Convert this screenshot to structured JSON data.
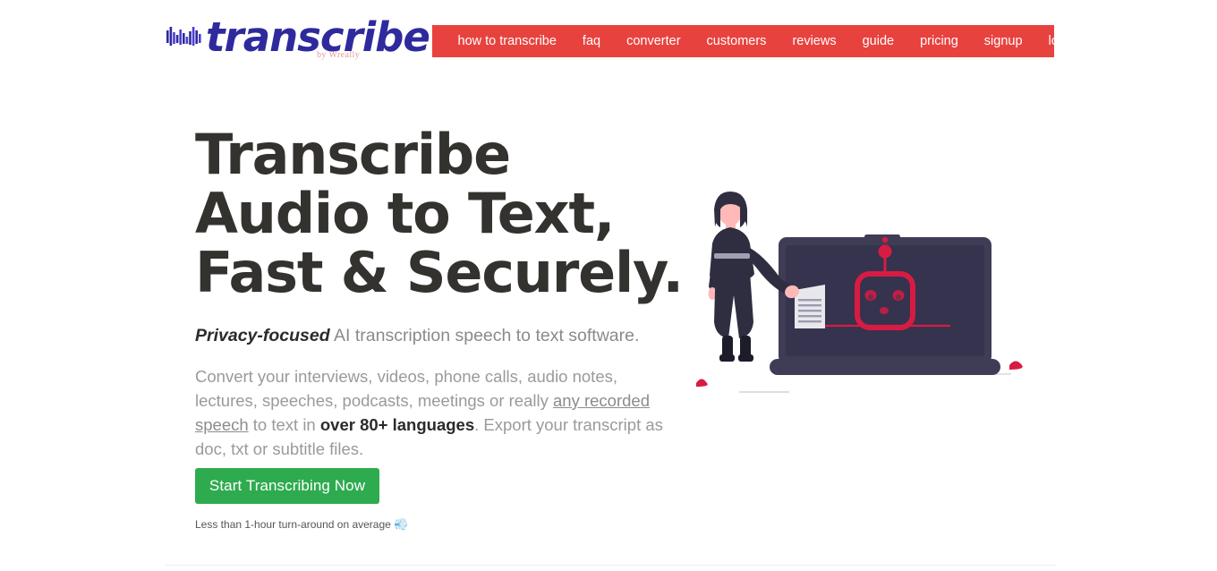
{
  "brand": {
    "wordmark": "transcribe",
    "tagline": "by Wreally",
    "logo_icon": "waveform-icon",
    "wordmark_color": "#2e2a9e",
    "tagline_color": "#e59aa0"
  },
  "nav": {
    "background_color": "#e8423f",
    "text_color": "#ffffff",
    "items": [
      {
        "label": "how to transcribe",
        "name": "nav-how-to-transcribe"
      },
      {
        "label": "faq",
        "name": "nav-faq"
      },
      {
        "label": "converter",
        "name": "nav-converter"
      },
      {
        "label": "customers",
        "name": "nav-customers"
      },
      {
        "label": "reviews",
        "name": "nav-reviews"
      },
      {
        "label": "guide",
        "name": "nav-guide"
      },
      {
        "label": "pricing",
        "name": "nav-pricing"
      },
      {
        "label": "signup",
        "name": "nav-signup"
      },
      {
        "label": "login",
        "name": "nav-login"
      }
    ]
  },
  "hero": {
    "heading_line1": "Transcribe",
    "heading_line2": "Audio to Text,",
    "heading_line3": "Fast & Securely.",
    "heading_color": "#33322f",
    "subheading_strong": "Privacy-focused",
    "subheading_rest": " AI transcription speech to text software.",
    "body_part1": "Convert your interviews, videos, phone calls, audio notes, lectures, speeches, podcasts, meetings or really ",
    "body_link": "any recorded speech",
    "body_part2": " to text in ",
    "body_bold": "over 80+ languages",
    "body_part3": ". Export your transcript as doc, txt or subtitle files."
  },
  "cta": {
    "button_label": "Start Transcribing Now",
    "button_color": "#2eab4f",
    "note_text": "Less than 1-hour turn-around on average",
    "note_emoji": "💨"
  },
  "illustration": {
    "name": "woman-with-laptop-robot-illustration",
    "description": "Woman standing beside a laptop showing a red robot face, holding a document",
    "colors": {
      "figure_dark": "#2f2e41",
      "skin": "#ffb9b9",
      "laptop_body": "#3f3d56",
      "laptop_screen": "#35334d",
      "robot_red": "#d81b43",
      "document": "#e6e6e6",
      "accent_red": "#d81b43"
    }
  },
  "divider": {
    "color": "#f0f0f2"
  }
}
